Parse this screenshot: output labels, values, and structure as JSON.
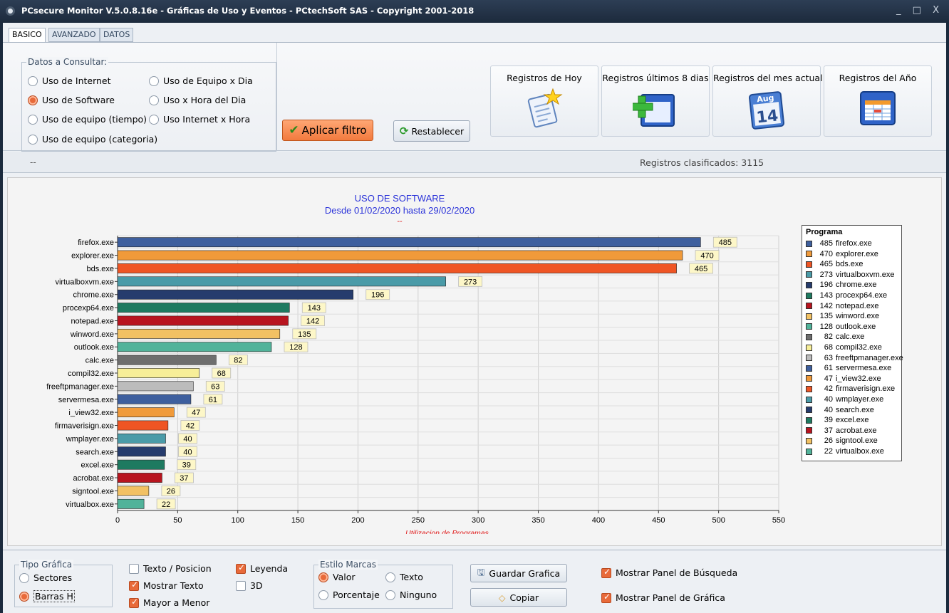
{
  "window": {
    "title": "PCsecure Monitor V.5.0.8.16e - Gráficas de Uso y Eventos - PCtechSoft SAS - Copyright 2001-2018",
    "controls": "_ □ X"
  },
  "tabs": [
    "BASICO",
    "AVANZADO",
    "DATOS"
  ],
  "filters": {
    "legend": "Datos a Consultar:",
    "options": [
      "Uso de Internet",
      "Uso de Software",
      "Uso de equipo (tiempo)",
      "Uso de equipo (categoria)",
      "Uso de Equipo x Dia",
      "Uso x Hora del Dia",
      "Uso Internet x Hora"
    ],
    "selected": "Uso de Software",
    "apply_label": "Aplicar filtro",
    "reset_label": "Restablecer"
  },
  "quick_buttons": [
    {
      "label": "Registros de Hoy",
      "icon": "document-star-icon"
    },
    {
      "label": "Registros últimos 8 dias",
      "icon": "window-add-icon"
    },
    {
      "label": "Registros del mes actual",
      "icon": "calendar-icon",
      "calendar_month": "Aug",
      "calendar_day": "14"
    },
    {
      "label": "Registros del Año",
      "icon": "spreadsheet-icon"
    }
  ],
  "status": {
    "left": "--",
    "count_label": "Registros clasificados: 3115"
  },
  "chart_data": {
    "type": "bar",
    "orientation": "horizontal",
    "title": "USO DE SOFTWARE",
    "subtitle": "Desde 01/02/2020 hasta 29/02/2020",
    "subtitle2": "--",
    "xlabel": "Utilizacion de Programas.",
    "xlim": [
      0,
      550
    ],
    "xticks": [
      0,
      50,
      100,
      150,
      200,
      250,
      300,
      350,
      400,
      450,
      500,
      550
    ],
    "grid": true,
    "legend_title": "Programa",
    "legend_position": "right",
    "categories": [
      "firefox.exe",
      "explorer.exe",
      "bds.exe",
      "virtualboxvm.exe",
      "chrome.exe",
      "procexp64.exe",
      "notepad.exe",
      "winword.exe",
      "outlook.exe",
      "calc.exe",
      "compil32.exe",
      "freeftpmanager.exe",
      "servermesa.exe",
      "i_view32.exe",
      "firmaverisign.exe",
      "wmplayer.exe",
      "search.exe",
      "excel.exe",
      "acrobat.exe",
      "signtool.exe",
      "virtualbox.exe"
    ],
    "values": [
      485,
      470,
      465,
      273,
      196,
      143,
      142,
      135,
      128,
      82,
      68,
      63,
      61,
      47,
      42,
      40,
      40,
      39,
      37,
      26,
      22
    ],
    "colors": [
      "#3e5f9e",
      "#f09a3a",
      "#ef5524",
      "#4a9ba8",
      "#263c6d",
      "#1e7a60",
      "#b8141f",
      "#f2c163",
      "#51b39a",
      "#6e6e6e",
      "#f7ee98",
      "#bcbcbc",
      "#3e5f9e",
      "#f09a3a",
      "#ef5524",
      "#4a9ba8",
      "#263c6d",
      "#1e7a60",
      "#b8141f",
      "#f2c163",
      "#51b39a"
    ]
  },
  "bottom": {
    "chart_type_legend": "Tipo Gráfica",
    "chart_types": [
      "Sectores",
      "Barras H"
    ],
    "chart_type_selected": "Barras H",
    "checks": [
      {
        "label": "Texto / Posicion",
        "checked": false
      },
      {
        "label": "Mostrar Texto",
        "checked": true
      },
      {
        "label": "Mayor a Menor",
        "checked": true
      },
      {
        "label": "Leyenda",
        "checked": true
      },
      {
        "label": "3D",
        "checked": false
      }
    ],
    "marks_legend": "Estilo Marcas",
    "marks": [
      "Valor",
      "Texto",
      "Porcentaje",
      "Ninguno"
    ],
    "marks_selected": "Valor",
    "save_label": "Guardar Grafica",
    "copy_label": "Copiar",
    "panel_checks": [
      {
        "label": "Mostrar Panel de Búsqueda",
        "checked": true
      },
      {
        "label": "Mostrar Panel de Gráfica",
        "checked": true
      }
    ]
  }
}
